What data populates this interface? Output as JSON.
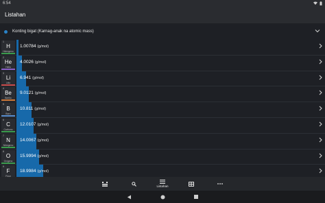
{
  "status": {
    "time": "6:54"
  },
  "appbar": {
    "title": "Listahan"
  },
  "sort": {
    "label": "Konting bigat (Karnag-anak na atomic mass)"
  },
  "unit": "(g/mol)",
  "elements": [
    {
      "number": "1",
      "symbol": "H",
      "name": "Hidrógeno",
      "mass": "1.00784",
      "mass_value": 1.00784,
      "group": "nonmetal"
    },
    {
      "number": "2",
      "symbol": "He",
      "name": "Helio",
      "mass": "4.0026",
      "mass_value": 4.0026,
      "group": "noble"
    },
    {
      "number": "3",
      "symbol": "Li",
      "name": "Litio",
      "mass": "6.941",
      "mass_value": 6.941,
      "group": "alkali"
    },
    {
      "number": "4",
      "symbol": "Be",
      "name": "Berilio",
      "mass": "9.0121",
      "mass_value": 9.0121,
      "group": "alkaline"
    },
    {
      "number": "5",
      "symbol": "B",
      "name": "Boro",
      "mass": "10.811",
      "mass_value": 10.811,
      "group": "metalloid"
    },
    {
      "number": "6",
      "symbol": "C",
      "name": "Carbono",
      "mass": "12.0107",
      "mass_value": 12.0107,
      "group": "nonmetal"
    },
    {
      "number": "7",
      "symbol": "N",
      "name": "Nitrógeno",
      "mass": "14.0067",
      "mass_value": 14.0067,
      "group": "nonmetal"
    },
    {
      "number": "8",
      "symbol": "O",
      "name": "Oxígeno",
      "mass": "15.9994",
      "mass_value": 15.9994,
      "group": "nonmetal"
    },
    {
      "number": "9",
      "symbol": "F",
      "name": "Flúor",
      "mass": "18.9984",
      "mass_value": 18.9984,
      "group": "halogen"
    }
  ],
  "bottom_nav": [
    {
      "icon": "elements-grid-icon",
      "label": ""
    },
    {
      "icon": "search-icon",
      "label": ""
    },
    {
      "icon": "list-icon",
      "label": "Listahan"
    },
    {
      "icon": "table-icon",
      "label": ""
    },
    {
      "icon": "more-icon",
      "label": ""
    }
  ],
  "colors": {
    "bar": "#1769aa",
    "accent": "#2a82c8",
    "background": "#1e2025"
  }
}
